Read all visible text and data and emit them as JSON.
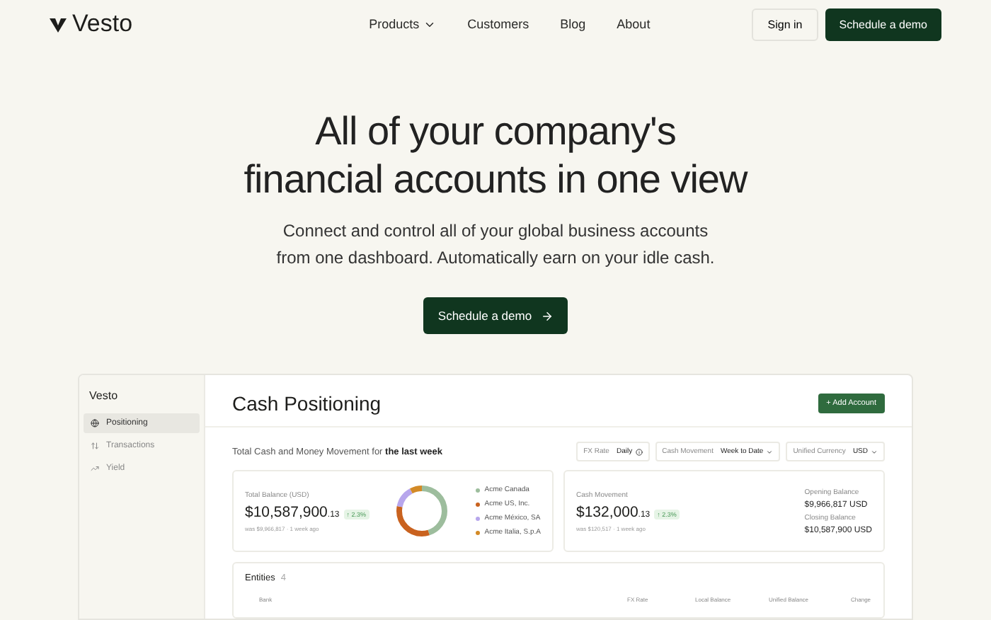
{
  "nav": {
    "logo": "Vesto",
    "links": [
      {
        "label": "Products",
        "dropdown": true
      },
      {
        "label": "Customers",
        "dropdown": false
      },
      {
        "label": "Blog",
        "dropdown": false
      },
      {
        "label": "About",
        "dropdown": false
      }
    ],
    "sign_in": "Sign in",
    "cta": "Schedule a demo"
  },
  "hero": {
    "title_lines": [
      "All of your company's",
      "financial accounts in one view"
    ],
    "subtitle_lines": [
      "Connect and control all of your global business accounts",
      "from one dashboard. Automatically earn on your idle cash."
    ],
    "button": "Schedule a demo"
  },
  "dashboard": {
    "logo": "Vesto",
    "sidebar": [
      {
        "label": "Positioning",
        "selected": true
      },
      {
        "label": "Transactions",
        "selected": false
      },
      {
        "label": "Yield",
        "selected": false
      }
    ],
    "title": "Cash Positioning",
    "add_button": "+ Add Account",
    "period_text": "Total Cash and Money Movement for **the last week**",
    "filters": [
      {
        "label": "FX Rate",
        "value": "Daily"
      },
      {
        "label": "Cash Movement",
        "value": "Week to Date"
      },
      {
        "label": "Unified Currency",
        "value": "USD"
      }
    ],
    "balance": {
      "label": "Total Balance (USD)",
      "amount": "$10,587,900",
      "cents": ".13",
      "change": "↑ 2.3%",
      "note": "was $9,966,817 · 1 week ago"
    },
    "legend": [
      {
        "label": "Acme Canada",
        "color": "#9dbd9d"
      },
      {
        "label": "Acme US, Inc.",
        "color": "#c9621f"
      },
      {
        "label": "Acme México, SA",
        "color": "#b7a6ec"
      },
      {
        "label": "Acme Italia, S.p.A",
        "color": "#d38a26"
      }
    ],
    "movement": {
      "label": "Cash Movement",
      "amount": "$132,000",
      "cents": ".13",
      "change": "↑ 2.3%",
      "note": "was $120,517 · 1 week ago"
    },
    "opening": {
      "label": "Opening Balance",
      "value": "$9,966,817 USD"
    },
    "closing": {
      "label": "Closing Balance",
      "value": "$10,587,900 USD"
    },
    "entities": {
      "title": "Entities",
      "count": "4",
      "columns": [
        "Bank",
        "FX Rate",
        "Local Balance",
        "Unified Balance",
        "Change"
      ]
    }
  }
}
